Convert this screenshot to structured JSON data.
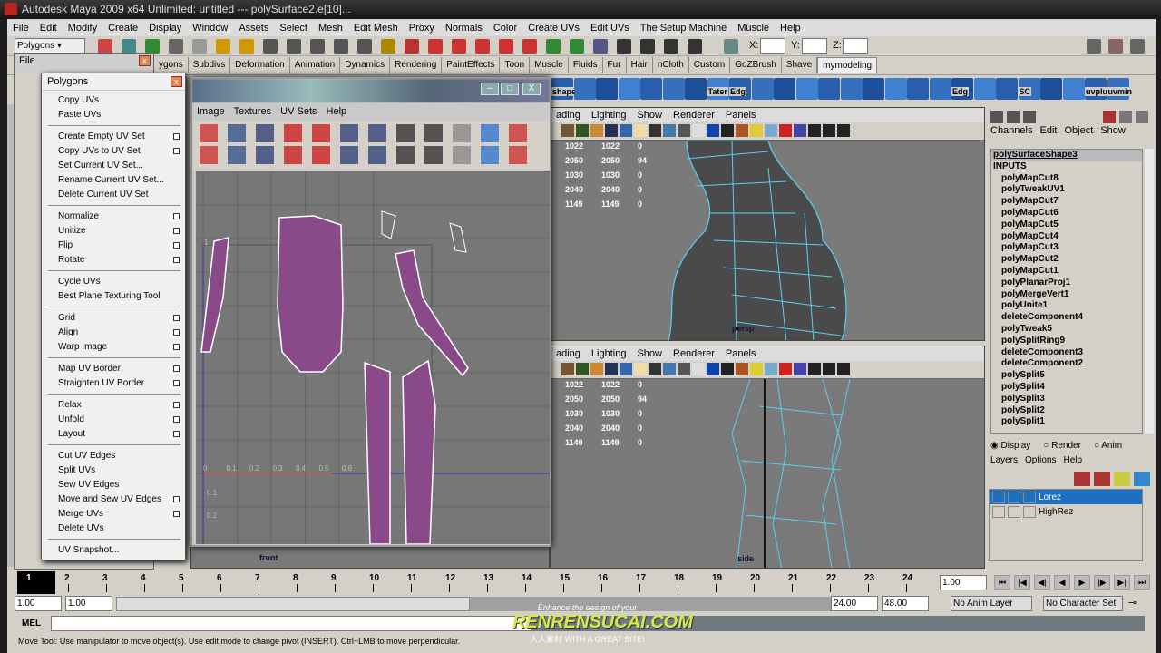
{
  "window": {
    "title": "Autodesk Maya 2009 x64 Unlimited: untitled   ---   polySurface2.e[10]..."
  },
  "menubar": [
    "File",
    "Edit",
    "Modify",
    "Create",
    "Display",
    "Window",
    "Assets",
    "Select",
    "Mesh",
    "Edit Mesh",
    "Proxy",
    "Normals",
    "Color",
    "Create UVs",
    "Edit UVs",
    "The Setup Machine",
    "Muscle",
    "Help"
  ],
  "statusline": {
    "menu_set": "Polygons",
    "x_label": "X:",
    "y_label": "Y:",
    "z_label": "Z:",
    "x_value": "",
    "y_value": "",
    "z_value": ""
  },
  "shelf": {
    "tabs": [
      "ygons",
      "Subdivs",
      "Deformation",
      "Animation",
      "Dynamics",
      "Rendering",
      "PaintEffects",
      "Toon",
      "Muscle",
      "Fluids",
      "Fur",
      "Hair",
      "nCloth",
      "Custom",
      "GoZBrush",
      "Shave",
      "mymodeling"
    ],
    "active_tab": "mymodeling",
    "icon_labels": [
      "shape",
      "Tater",
      "Edg",
      "Edg",
      "SC",
      "uvplu",
      "uvmin"
    ]
  },
  "file_window": {
    "title": "File"
  },
  "polygons_menu": {
    "title": "Polygons",
    "items": [
      {
        "label": "Copy UVs"
      },
      {
        "label": "Paste UVs"
      },
      {
        "label": "Create Empty UV Set",
        "sep": true,
        "opt": true
      },
      {
        "label": "Copy UVs to UV Set",
        "opt": true
      },
      {
        "label": "Set Current UV Set..."
      },
      {
        "label": "Rename Current UV Set..."
      },
      {
        "label": "Delete Current UV Set"
      },
      {
        "label": "Normalize",
        "sep": true,
        "opt": true
      },
      {
        "label": "Unitize",
        "opt": true
      },
      {
        "label": "Flip",
        "opt": true
      },
      {
        "label": "Rotate",
        "opt": true
      },
      {
        "label": "Cycle UVs",
        "sep": true
      },
      {
        "label": "Best Plane Texturing Tool"
      },
      {
        "label": "Grid",
        "sep": true,
        "opt": true
      },
      {
        "label": "Align",
        "opt": true
      },
      {
        "label": "Warp Image",
        "opt": true
      },
      {
        "label": "Map UV Border",
        "sep": true,
        "opt": true
      },
      {
        "label": "Straighten UV Border",
        "opt": true
      },
      {
        "label": "Relax",
        "sep": true,
        "opt": true
      },
      {
        "label": "Unfold",
        "opt": true
      },
      {
        "label": "Layout",
        "opt": true
      },
      {
        "label": "Cut UV Edges",
        "sep": true
      },
      {
        "label": "Split UVs"
      },
      {
        "label": "Sew UV Edges"
      },
      {
        "label": "Move and Sew UV Edges",
        "opt": true
      },
      {
        "label": "Merge UVs",
        "opt": true
      },
      {
        "label": "Delete UVs"
      },
      {
        "label": "UV Snapshot...",
        "sep": true
      }
    ]
  },
  "uv_editor": {
    "menu": [
      "Image",
      "Textures",
      "UV Sets",
      "Help"
    ],
    "u_ticks": [
      "0",
      "0.1",
      "0.2",
      "0.3",
      "0.4",
      "0.5",
      "0.6"
    ],
    "v_ticks_below": [
      "0.1",
      "0.2"
    ],
    "v_top_label": "1"
  },
  "viewport_menu": [
    "ading",
    "Lighting",
    "Show",
    "Renderer",
    "Panels"
  ],
  "hud_rows": [
    [
      "1022",
      "1022",
      "0"
    ],
    [
      "2050",
      "2050",
      "94"
    ],
    [
      "1030",
      "1030",
      "0"
    ],
    [
      "2040",
      "2040",
      "0"
    ],
    [
      "1149",
      "1149",
      "0"
    ]
  ],
  "cameras": {
    "persp": "persp",
    "front": "front",
    "side": "side"
  },
  "channel_box": {
    "menu": [
      "Channels",
      "Edit",
      "Object",
      "Show"
    ],
    "object": "polySurfaceShape3",
    "inputs_label": "INPUTS",
    "inputs": [
      "polyMapCut8",
      "polyTweakUV1",
      "polyMapCut7",
      "polyMapCut6",
      "polyMapCut5",
      "polyMapCut4",
      "polyMapCut3",
      "polyMapCut2",
      "polyMapCut1",
      "polyPlanarProj1",
      "polyMergeVert1",
      "polyUnite1",
      "deleteComponent4",
      "polyTweak5",
      "polySplitRing9",
      "deleteComponent3",
      "deleteComponent2",
      "polySplit5",
      "polySplit4",
      "polySplit3",
      "polySplit2",
      "polySplit1"
    ]
  },
  "layers": {
    "modes": [
      "Display",
      "Render",
      "Anim"
    ],
    "selected_mode": "Display",
    "menu": [
      "Layers",
      "Options",
      "Help"
    ],
    "items": [
      {
        "name": "Lorez",
        "selected": true
      },
      {
        "name": "HighRez",
        "selected": false
      }
    ]
  },
  "timeline": {
    "frames": [
      "1",
      "2",
      "3",
      "4",
      "5",
      "6",
      "7",
      "8",
      "9",
      "10",
      "11",
      "12",
      "13",
      "14",
      "15",
      "16",
      "17",
      "18",
      "19",
      "20",
      "21",
      "22",
      "23",
      "24"
    ],
    "current_frame": "1",
    "current_time": "1.00"
  },
  "range": {
    "start": "1.00",
    "playback_start": "1.00",
    "playback_end": "24.00",
    "end": "48.00",
    "anim_layer": "No Anim Layer",
    "character_set": "No Character Set"
  },
  "command": {
    "label": "MEL",
    "value": ""
  },
  "helpline": "Move Tool: Use manipulator to move object(s). Use edit mode to change pivot (INSERT).  Ctrl+LMB to move perpendicular.",
  "watermark": {
    "line1": "Enhance the design of your",
    "brand": "RENRENSUCAI.COM",
    "line2": "人人素材 WITH A GREAT SITE!"
  },
  "colors": {
    "uv_shell": "#8a4a8a",
    "wire_selected": "#5ad0f0",
    "layer_selected": "#1e6fc0",
    "viewport_bg": "#7a7a7a"
  }
}
